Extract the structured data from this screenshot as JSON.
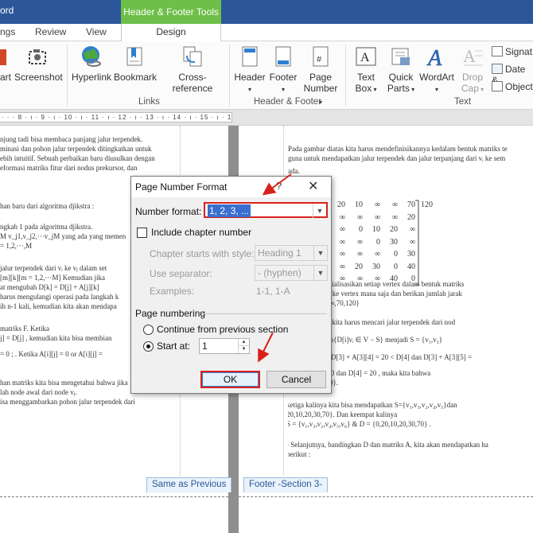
{
  "window": {
    "title_fragment": "ord"
  },
  "contextual_tab": {
    "group": "Header & Footer Tools",
    "tab": "Design"
  },
  "tabs": [
    "ngs",
    "Review",
    "View"
  ],
  "ribbon": {
    "buttons": {
      "art": "art",
      "screenshot": "Screenshot",
      "hyperlink": "Hyperlink",
      "bookmark": "Bookmark",
      "cross_reference": "Cross-reference",
      "header": "Header",
      "footer": "Footer",
      "page_number_line1": "Page",
      "page_number_line2": "Number",
      "text_box_line1": "Text",
      "text_box_line2": "Box",
      "quick_parts_line1": "Quick",
      "quick_parts_line2": "Parts",
      "wordart": "WordArt",
      "drop_cap_line1": "Drop",
      "drop_cap_line2": "Cap",
      "signature": "Signat",
      "date_time": "Date &",
      "object": "Object"
    },
    "groups": {
      "links": "Links",
      "header_footer": "Header & Footer",
      "text": "Text"
    }
  },
  "ruler": {
    "ticks": "· · · 8 · ı · 9 · ı · 10 · ı · 11 · ı · 12 · ı · 13 · ı · 14 · ı · 15 · ı · 16 · ı · 17 · ı · 18 ·"
  },
  "doc_left_lines": [
    "njung tadi bisa membaca panjang jalur terpendek.",
    "minasi dan pohon jalur terpendek ditingkatkan untuk",
    "ebih intuitif. Sebuah perbaikan baru diusulkan dengan",
    "eformasi matriks fitur dari nodus prekursor, dan",
    "han baru dari algoritma djikstra :",
    "ngkah 1 pada algoritma djikstra.",
    "M v_j1,v_j2,···v_jM   yang ada yang memen",
    "= 1,2,···,M",
    "jalur terpendek dari vᵢ ke vⱼ dalam set",
    "[m][k][m = 1,2,···M]   Kemudian jika",
    "at mengubah         D[k] = D[j] + A[j][k]",
    "harus mengulangi operasi pada langkah k",
    "ih n-1 kali, kemudian kita akan mendapa",
    "matriks F. Ketika",
    "j] = D[j] ,  kemudian kita bisa membian",
    "= 0 ;  . Ketika   A[i][j] = 0   or   A[i][j] =",
    "han matriks kita bisa mengetahui bahwa jika",
    "lah node awal dari node vⱼ.",
    "isa menggambarkan pohon jalur terpendek dari"
  ],
  "doc_right_lines": [
    "Pada gambar diatas kita harus mendefinisikannya kedalam bentuk matriks te",
    "guna untuk mendapatkan jalur terpendek dan jalur terpanjang dari vᵢ ke sem",
    "ada.",
    "bagai berikut :",
    "ah pertama, inisialisasikan setiap vertex dalam bentuk matriks",
    "1 dapat menuju ke vertex mana saja dan berikan jumlah jarak",
    ", D = {0,20,10,∞,70,120}",
    "h kedua, dari vᵢ kita harus mencari jalur terpendek dari nod",
    "D[3] = 10 = min{D[i]vᵢ ∈ V − S}   menjadi   S = {v₁,v₃}",
    "h ketiga, untuk D[3] + A[3][4] = 20 < D[4]  dan  D[3] + A[3][5] =",
    "ifikasi   D[4] = 20   dan   D[4] = 20 , maka kita bahwa",
    "20,10,20,30,120}.",
    "ketiga kalinya kita bisa mendapatkan   S={v₁,v₃,v₂,v₄,v₅}dan",
    "20,10,20,30,70}. Dan keempat kalinya",
    "S = {v₁,v₃,v₂,v₄,v₅,v₆} & D = {0,20,10,20,30,70} .",
    "-   Selanjutnya, bandingkan D dan matriks A, kita akan mendapatkan ha",
    "berikut :"
  ],
  "matrix_rows": [
    [
      "20",
      "10",
      "∞",
      "∞",
      "70",
      "120"
    ],
    [
      "∞",
      "∞",
      "∞",
      "∞",
      "20"
    ],
    [
      "∞",
      "0",
      "10",
      "20",
      "∞"
    ],
    [
      "∞",
      "∞",
      "0",
      "30",
      "∞"
    ],
    [
      "∞",
      "∞",
      "∞",
      "0",
      "30"
    ],
    [
      "∞",
      "20",
      "30",
      "0",
      "40"
    ],
    [
      "∞",
      "∞",
      "∞",
      "40",
      "0"
    ]
  ],
  "footer_tags": {
    "same_as_previous": "Same as Previous",
    "footer_section": "Footer -Section 3-"
  },
  "dialog": {
    "title": "Page Number Format",
    "help": "?",
    "close": "✕",
    "number_format_label": "Number format:",
    "number_format_value": "1, 2, 3, ...",
    "include_chapter_label": "Include chapter number",
    "include_chapter_checked": false,
    "chapter_style_label": "Chapter starts with style:",
    "chapter_style_value": "Heading 1",
    "separator_label": "Use separator:",
    "separator_value": "-   (hyphen)",
    "examples_label": "Examples:",
    "examples_value": "1-1, 1-A",
    "page_numbering_label": "Page numbering",
    "continue_label": "Continue from previous section",
    "start_at_label": "Start at:",
    "start_at_value": "1",
    "start_at_selected": true,
    "ok_label": "OK",
    "cancel_label": "Cancel"
  },
  "colors": {
    "word_blue": "#2b579a",
    "contextual_green": "#6dbf49",
    "annotation_red": "#d9211b"
  }
}
